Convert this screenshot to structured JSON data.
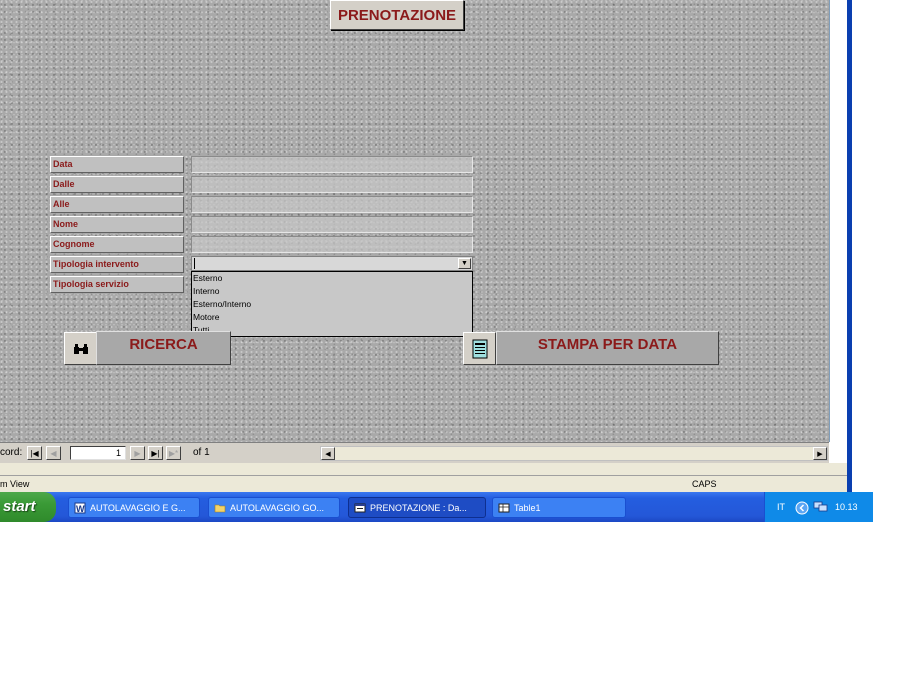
{
  "form": {
    "title_button": "PRENOTAZIONE",
    "fields": [
      {
        "label": "Data"
      },
      {
        "label": "Dalle"
      },
      {
        "label": "Alle"
      },
      {
        "label": "Nome"
      },
      {
        "label": "Cognome"
      },
      {
        "label": "Tipologia intervento"
      },
      {
        "label": "Tipologia servizio"
      }
    ],
    "dropdown_options": [
      "Esterno",
      "Interno",
      "Esterno/Interno",
      "Motore",
      "Tutti"
    ],
    "search_button": "RICERCA",
    "print_button": "STAMPA PER DATA"
  },
  "navigator": {
    "record_label": "cord:",
    "current_record": "1",
    "of_text": "of 1"
  },
  "status_bar": {
    "view_text": "m View",
    "caps": "CAPS"
  },
  "taskbar": {
    "start_label": "start",
    "tasks": [
      {
        "label": "AUTOLAVAGGIO E G...",
        "icon": "word-doc-icon"
      },
      {
        "label": "AUTOLAVAGGIO GO...",
        "icon": "folder-icon"
      },
      {
        "label": "PRENOTAZIONE : Da...",
        "icon": "access-form-icon"
      },
      {
        "label": "Table1",
        "icon": "table-icon"
      }
    ],
    "tray": {
      "language": "IT",
      "clock": "10.13"
    }
  },
  "colors": {
    "label_text": "#8b1a1a",
    "taskbar_blue": "#245ee0",
    "start_green": "#3a9a36",
    "tray_blue": "#0f8ae8"
  }
}
